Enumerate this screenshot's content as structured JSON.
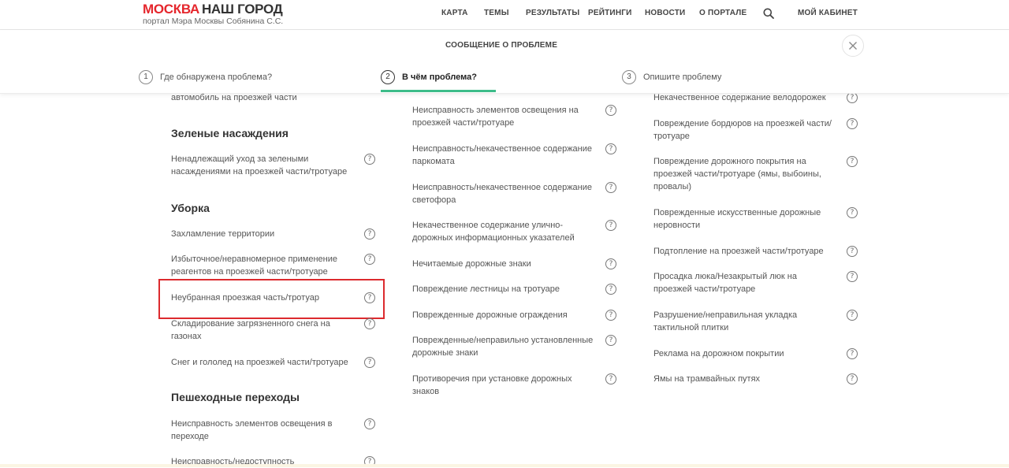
{
  "header": {
    "logo_red": "МОСКВА",
    "logo_dark": "НАШ ГОРОД",
    "logo_sub": "портал Мэра Москвы Собянина С.С.",
    "nav": [
      "КАРТА",
      "ТЕМЫ",
      "РЕЗУЛЬТАТЫ",
      "РЕЙТИНГИ",
      "НОВОСТИ",
      "О ПОРТАЛЕ"
    ],
    "cabinet": "МОЙ КАБИНЕТ",
    "search_icon": "search-icon"
  },
  "modal": {
    "title": "СООБЩЕНИЕ О ПРОБЛЕМЕ",
    "close_icon": "close-icon",
    "steps": [
      {
        "num": "1",
        "label": "Где обнаружена проблема?"
      },
      {
        "num": "2",
        "label": "В чём проблема?"
      },
      {
        "num": "3",
        "label": "Опишите проблему"
      }
    ],
    "active_step": 2,
    "accent_color": "#3dbc8a"
  },
  "help_glyph": "?",
  "col1": {
    "partial_top": "автомобиль на проезжей части",
    "cat_green": "Зеленые насаждения",
    "green_items": [
      "Ненадлежащий уход за зелеными насаждениями на проезжей части/тротуаре"
    ],
    "cat_cleaning": "Уборка",
    "cleaning_items": [
      "Захламление территории",
      "Избыточное/неравномерное применение реагентов на проезжей части/тротуаре",
      "Неубранная проезжая часть/тротуар",
      "Складирование загрязненного снега на газонах",
      "Снег и гололед на проезжей части/тротуаре"
    ],
    "cat_crossings": "Пешеходные переходы",
    "crossing_items": [
      "Неисправность элементов освещения в переходе",
      "Неисправность/недоступность"
    ]
  },
  "col2": {
    "items": [
      "Неисправность элементов освещения на проезжей части/тротуаре",
      "Неисправность/некачественное содержание паркомата",
      "Неисправность/некачественное содержание светофора",
      "Некачественное содержание улично-дорожных информационных указателей",
      "Нечитаемые дорожные знаки",
      "Повреждение лестницы на тротуаре",
      "Поврежденные дорожные ограждения",
      "Поврежденные/неправильно установленные дорожные знаки",
      "Противоречия при установке дорожных знаков"
    ]
  },
  "col3": {
    "items": [
      "Некачественное содержание велодорожек",
      "Повреждение бордюров на проезжей части/тротуаре",
      "Повреждение дорожного покрытия на проезжей части/тротуаре (ямы, выбоины, провалы)",
      "Поврежденные искусственные дорожные неровности",
      "Подтопление на проезжей части/тротуаре",
      "Просадка люка/Незакрытый люк на проезжей части/тротуаре",
      "Разрушение/неправильная укладка тактильной плитки",
      "Реклама на дорожном покрытии",
      "Ямы на трамвайных путях"
    ]
  },
  "highlight_color": "#dc2a2e"
}
